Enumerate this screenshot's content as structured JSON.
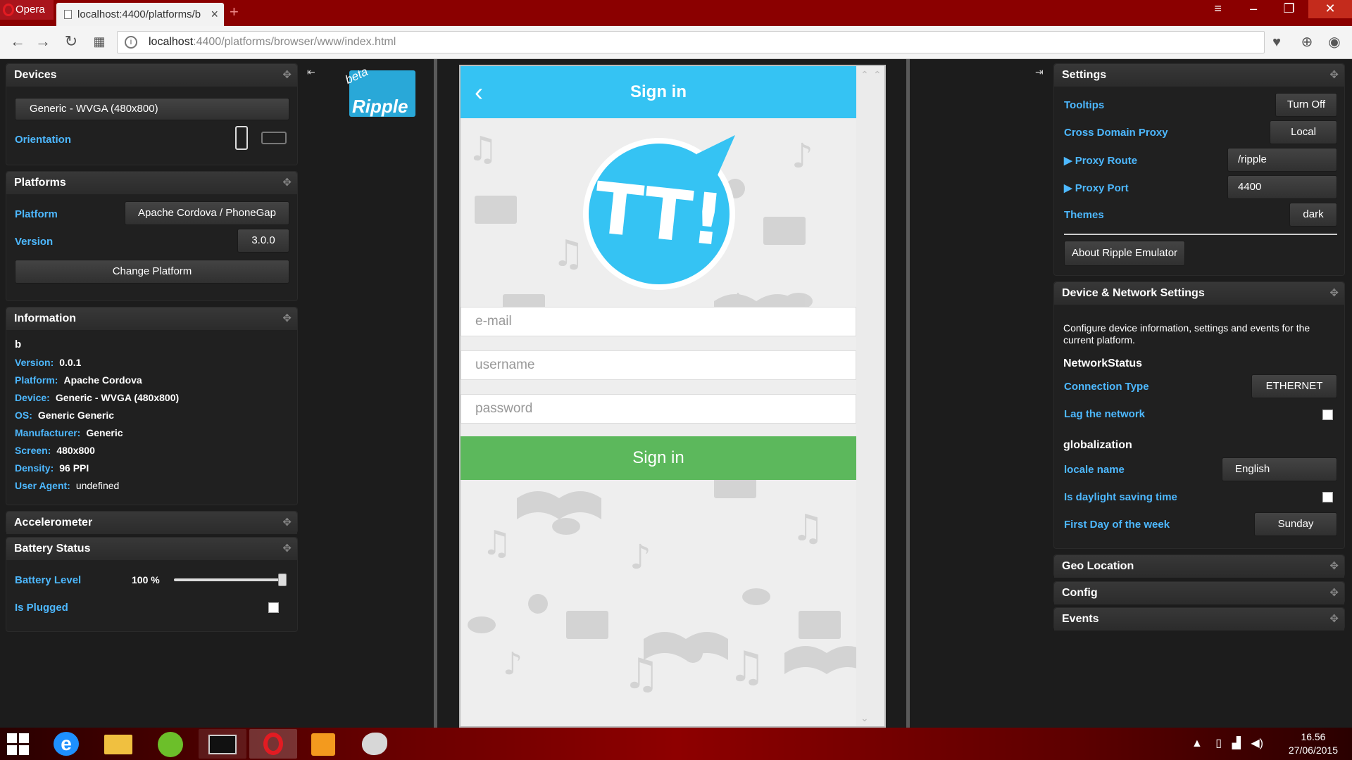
{
  "browser": {
    "menu_label": "Opera",
    "tab_title": "localhost:4400/platforms/b",
    "url_host": "localhost",
    "url_rest": ":4400/platforms/browser/www/index.html"
  },
  "left": {
    "devices": {
      "title": "Devices",
      "device_select": "Generic - WVGA (480x800)",
      "orientation_label": "Orientation"
    },
    "platforms": {
      "title": "Platforms",
      "platform_label": "Platform",
      "platform_value": "Apache Cordova / PhoneGap",
      "version_label": "Version",
      "version_value": "3.0.0",
      "change_button": "Change Platform"
    },
    "information": {
      "title": "Information",
      "app_name": "b",
      "rows": [
        {
          "k": "Version:",
          "v": "0.0.1"
        },
        {
          "k": "Platform:",
          "v": "Apache Cordova"
        },
        {
          "k": "Device:",
          "v": "Generic - WVGA (480x800)"
        },
        {
          "k": "OS:",
          "v": "Generic Generic"
        },
        {
          "k": "Manufacturer:",
          "v": "Generic"
        },
        {
          "k": "Screen:",
          "v": "480x800"
        },
        {
          "k": "Density:",
          "v": "96 PPI"
        },
        {
          "k": "User Agent:",
          "v": "undefined"
        }
      ]
    },
    "accelerometer": {
      "title": "Accelerometer"
    },
    "battery": {
      "title": "Battery Status",
      "level_label": "Battery Level",
      "level_value": "100 %",
      "level_fraction": 1.0,
      "plugged_label": "Is Plugged"
    }
  },
  "ripple": {
    "beta": "beta",
    "word": "Ripple"
  },
  "app": {
    "title": "Sign in",
    "email_placeholder": "e-mail",
    "username_placeholder": "username",
    "password_placeholder": "password",
    "signin_button": "Sign in",
    "logo_text": "TT!"
  },
  "right": {
    "settings": {
      "title": "Settings",
      "tooltips_label": "Tooltips",
      "tooltips_button": "Turn Off",
      "proxy_label": "Cross Domain Proxy",
      "proxy_value": "Local",
      "route_label": "▶ Proxy Route",
      "route_value": "/ripple",
      "port_label": "▶ Proxy Port",
      "port_value": "4400",
      "themes_label": "Themes",
      "themes_value": "dark",
      "about_button": "About Ripple Emulator"
    },
    "device_network": {
      "title": "Device & Network Settings",
      "description": "Configure device information, settings and events for the current platform.",
      "network_heading": "NetworkStatus",
      "connection_label": "Connection Type",
      "connection_value": "ETHERNET",
      "lag_label": "Lag the network",
      "glob_heading": "globalization",
      "locale_label": "locale name",
      "locale_value": "English",
      "dst_label": "Is daylight saving time",
      "firstday_label": "First Day of the week",
      "firstday_value": "Sunday"
    },
    "geo": {
      "title": "Geo Location"
    },
    "config": {
      "title": "Config"
    },
    "events": {
      "title": "Events"
    }
  },
  "taskbar": {
    "time": "16.56",
    "date": "27/06/2015"
  },
  "colors": {
    "accent_blue": "#4db8ff",
    "app_bar": "#35c3f3",
    "signin_green": "#5cb85c",
    "titlebar_red": "#8b0000"
  }
}
